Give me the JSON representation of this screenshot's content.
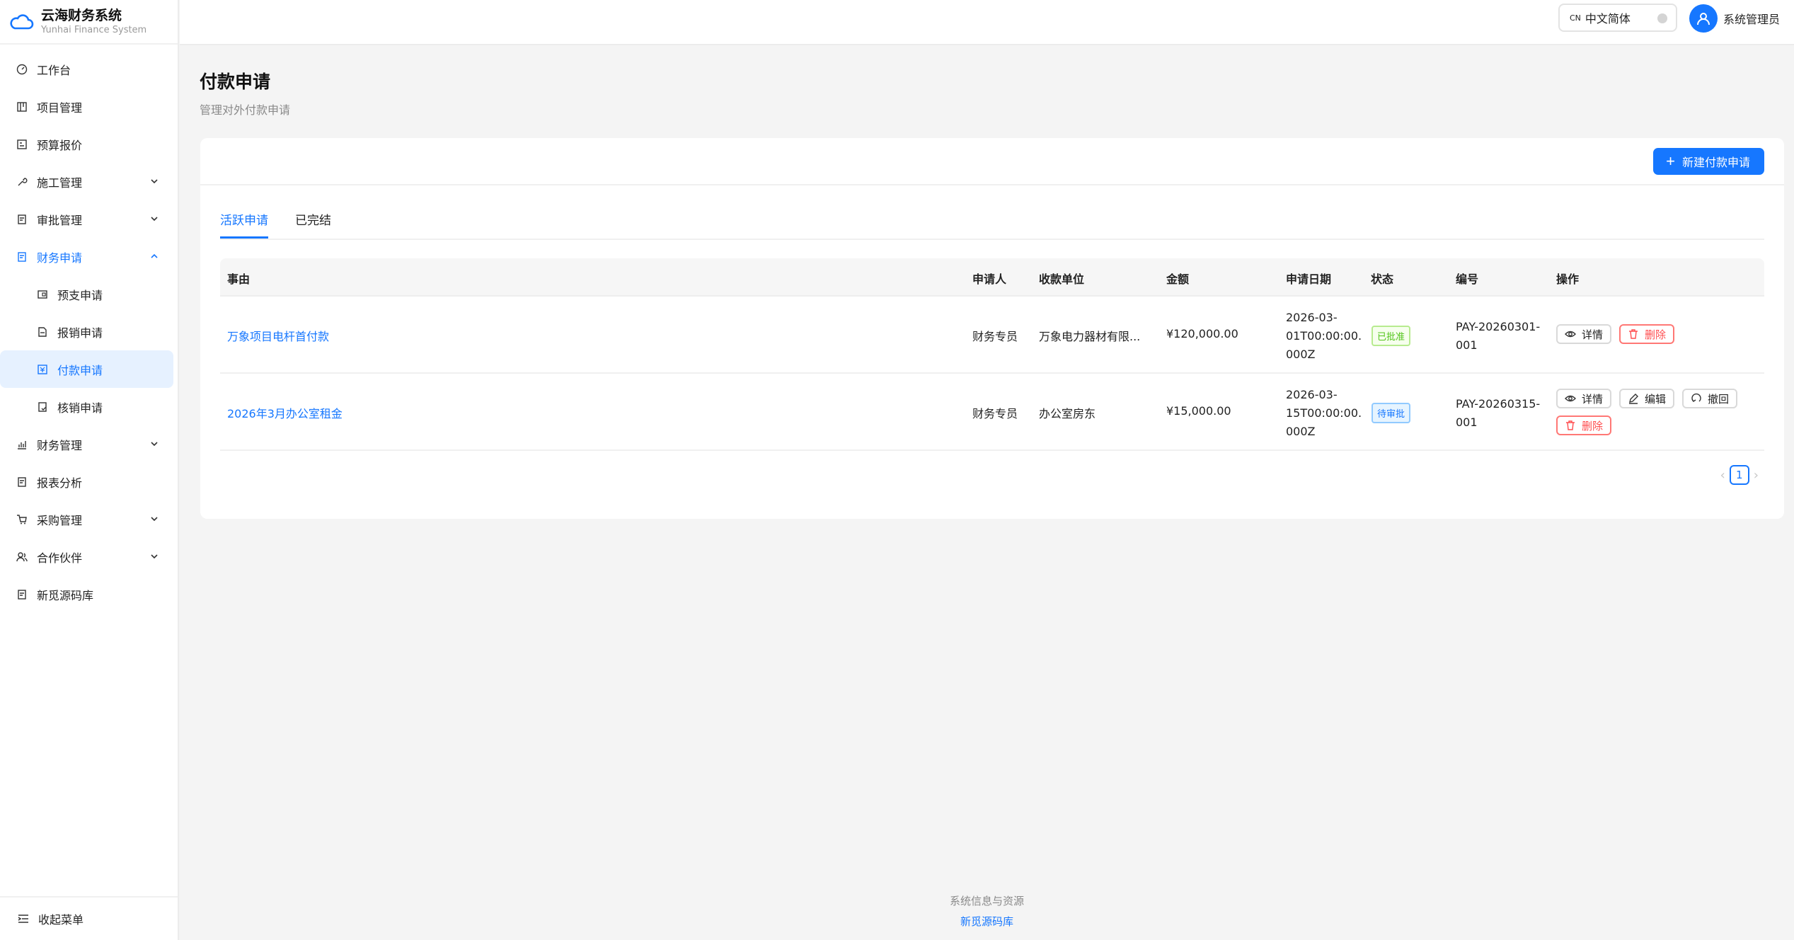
{
  "brand": {
    "title": "云海财务系统",
    "subtitle": "Yunhai Finance System"
  },
  "menu": [
    {
      "label": "工作台",
      "icon": "dashboard-icon"
    },
    {
      "label": "项目管理",
      "icon": "project-icon"
    },
    {
      "label": "预算报价",
      "icon": "budget-icon"
    },
    {
      "label": "施工管理",
      "icon": "wrench-icon",
      "expandable": true
    },
    {
      "label": "审批管理",
      "icon": "approval-icon",
      "expandable": true
    },
    {
      "label": "财务申请",
      "icon": "finance-apply-icon",
      "expandable": true,
      "open": true
    },
    {
      "label": "财务管理",
      "icon": "bar-chart-icon",
      "expandable": true
    },
    {
      "label": "报表分析",
      "icon": "report-icon"
    },
    {
      "label": "采购管理",
      "icon": "cart-icon",
      "expandable": true
    },
    {
      "label": "合作伙伴",
      "icon": "partner-icon",
      "expandable": true
    },
    {
      "label": "新觅源码库",
      "icon": "repo-icon"
    }
  ],
  "submenu": [
    {
      "label": "预支申请",
      "icon": "advance-icon"
    },
    {
      "label": "报销申请",
      "icon": "reimburse-icon"
    },
    {
      "label": "付款申请",
      "icon": "payment-icon",
      "active": true
    },
    {
      "label": "核销申请",
      "icon": "writeoff-icon"
    }
  ],
  "collapse_label": "收起菜单",
  "topbar": {
    "lang_code": "CN",
    "lang_label": "中文简体",
    "user_name": "系统管理员"
  },
  "page": {
    "title": "付款申请",
    "subtitle": "管理对外付款申请"
  },
  "new_button": "新建付款申请",
  "tabs": [
    "活跃申请",
    "已完结"
  ],
  "columns": [
    "事由",
    "申请人",
    "收款单位",
    "金额",
    "申请日期",
    "状态",
    "编号",
    "操作"
  ],
  "rows": [
    {
      "reason": "万象项目电杆首付款",
      "applicant": "财务专员",
      "payee": "万象电力器材有限...",
      "amount": "¥120,000.00",
      "date_lines": [
        "2026-03-",
        "01T00:00:00.",
        "000Z"
      ],
      "status": "已批准",
      "code_lines": [
        "PAY-20260301-",
        "001"
      ],
      "actions": [
        "详情",
        "删除"
      ]
    },
    {
      "reason": "2026年3月办公室租金",
      "applicant": "财务专员",
      "payee": "办公室房东",
      "amount": "¥15,000.00",
      "date_lines": [
        "2026-03-",
        "15T00:00:00.",
        "000Z"
      ],
      "status": "待审批",
      "code_lines": [
        "PAY-20260315-",
        "001"
      ],
      "actions": [
        "详情",
        "编辑",
        "撤回",
        "删除"
      ]
    }
  ],
  "pagination": {
    "current": "1"
  },
  "footer": {
    "line1": "系统信息与资源",
    "link": "新觅源码库"
  },
  "colors": {
    "primary": "#1677ff",
    "success": "#52c41a",
    "danger": "#ff4d4f"
  }
}
